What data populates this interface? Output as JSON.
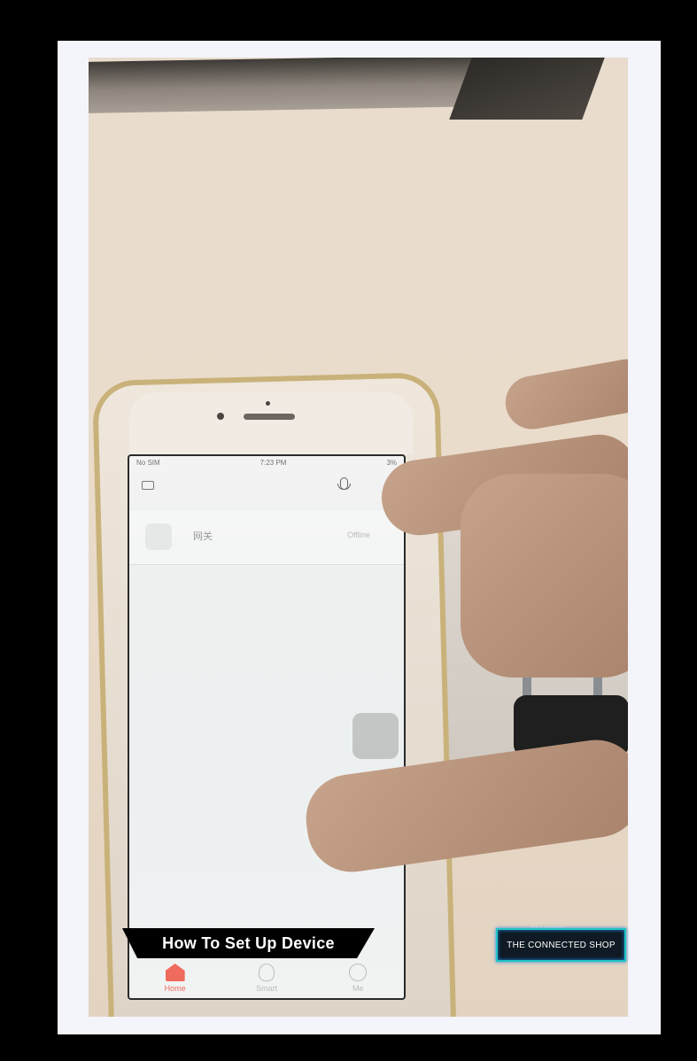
{
  "status_bar": {
    "carrier": "No SIM",
    "time": "7:23 PM",
    "battery": "3%"
  },
  "device": {
    "name": "网关",
    "status": "Offline"
  },
  "tabs": [
    {
      "label": "Home"
    },
    {
      "label": "Smart"
    },
    {
      "label": "Me"
    }
  ],
  "caption": "How To Set Up Device",
  "brand": {
    "tagline": "GET SMART",
    "name": "THE CONNECTED SHOP"
  }
}
